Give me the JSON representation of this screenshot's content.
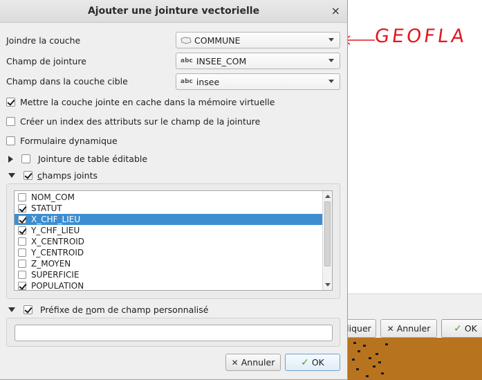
{
  "dialog": {
    "title": "Ajouter une jointure vectorielle",
    "close_glyph": "×",
    "join_layer": {
      "label": "Joindre la couche",
      "value": "COMMUNE",
      "icon": "polygon-layer-icon"
    },
    "join_field": {
      "label": "Champ de jointure",
      "value": "INSEE_COM",
      "type_icon_text": "abc"
    },
    "target_field": {
      "label": "Champ dans la couche cible",
      "value": "insee",
      "type_icon_text": "abc"
    },
    "cache_checkbox": {
      "label": "Mettre la couche jointe en cache dans la mémoire virtuelle",
      "checked": true
    },
    "index_checkbox": {
      "label": "Créer un index des attributs sur le champ de la jointure",
      "checked": false
    },
    "dynamic_form_checkbox": {
      "label": "Formulaire dynamique",
      "checked": false
    },
    "editable_join": {
      "label": "Jointure de table éditable",
      "checked": false,
      "expanded": false
    },
    "joined_fields": {
      "label_pre": "",
      "label_ul": "c",
      "label_post": "hamps joints",
      "checked": true,
      "expanded": true,
      "items": [
        {
          "name": "NOM_COM",
          "checked": false,
          "selected": false
        },
        {
          "name": "STATUT",
          "checked": true,
          "selected": false
        },
        {
          "name": "X_CHF_LIEU",
          "checked": true,
          "selected": true
        },
        {
          "name": "Y_CHF_LIEU",
          "checked": true,
          "selected": false
        },
        {
          "name": "X_CENTROID",
          "checked": false,
          "selected": false
        },
        {
          "name": "Y_CENTROID",
          "checked": false,
          "selected": false
        },
        {
          "name": "Z_MOYEN",
          "checked": false,
          "selected": false
        },
        {
          "name": "SUPERFICIE",
          "checked": false,
          "selected": false
        },
        {
          "name": "POPULATION",
          "checked": true,
          "selected": false
        }
      ]
    },
    "prefix": {
      "label_pre": "Préfixe de ",
      "label_ul": "n",
      "label_post": "om de champ personnalisé",
      "checked": true,
      "expanded": true,
      "value": ""
    },
    "buttons": {
      "cancel": "Annuler",
      "ok": "OK"
    }
  },
  "background": {
    "buttons": {
      "apply_partial": "pliquer",
      "cancel": "Annuler",
      "ok": "OK"
    }
  },
  "annotation": {
    "text": "GEOFLA",
    "color": "#e0191f"
  }
}
